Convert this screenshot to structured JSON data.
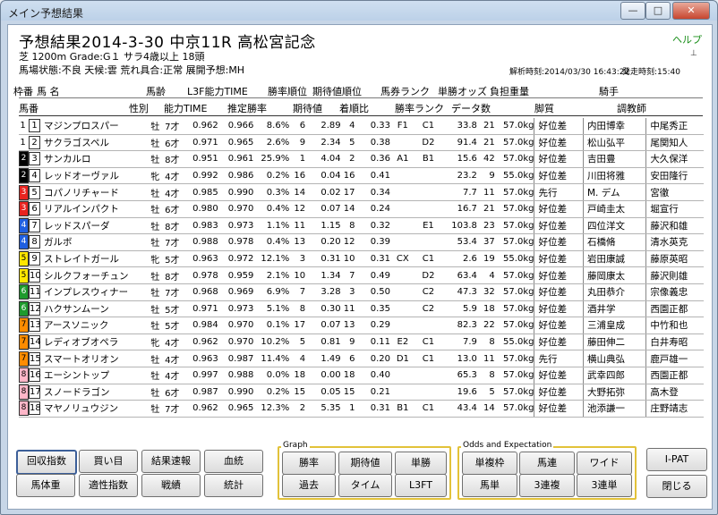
{
  "window": {
    "title": "メイン予想結果",
    "min": "—",
    "max": "□",
    "close": "✕"
  },
  "header": {
    "main": "予想結果2014-3-30 中京11R 高松宮記念",
    "help": "ヘルプ",
    "pin": "⊥",
    "line2": "芝 1200m  Grade:G１ サラ4歳以上 18頭",
    "line3": "馬場状態:不良  天候:雲  荒れ具合:正常  展開予想:MH",
    "analysis_time": "解析時刻:2014/03/30 16:43:22",
    "start_time": "発走時刻:15:40"
  },
  "columns_top": [
    "枠番",
    "馬 名",
    "馬齢",
    "L3F能力TIME",
    "勝率順位",
    "期待値順位",
    "馬券ランク",
    "単勝オッズ",
    "負担重量",
    "騎手"
  ],
  "columns_bottom": [
    "馬番",
    "性別",
    "能力TIME",
    "推定勝率",
    "期待値",
    "着順比",
    "勝率ランク",
    "データ数",
    "脚質",
    "調教師"
  ],
  "colors": {
    "frame1": "#ffffff",
    "frame2": "#000000",
    "frame3": "#e8231f",
    "frame4": "#1f5fe0",
    "frame5": "#ffe600",
    "frame6": "#1e9a2c",
    "frame7": "#ff8c00",
    "frame8": "#ffb6c8",
    "accent": "#e2c23a"
  },
  "rows": [
    {
      "w": "1",
      "n": "1",
      "name": "マジンプロスパー",
      "sex": "牡",
      "age": "7才",
      "t1": "0.962",
      "t2": "0.966",
      "rate": "8.6%",
      "rr": "6",
      "ev": "2.89",
      "er": "4",
      "cr": "0.33",
      "rk1": "F1",
      "rk2": "C1",
      "odds": "33.8",
      "dc": "21",
      "wt": "57.0kg",
      "style": "好位差",
      "jockey": "内田博幸",
      "trainer": "中尾秀正"
    },
    {
      "w": "1",
      "n": "2",
      "name": "サクラゴスペル",
      "sex": "牡",
      "age": "6才",
      "t1": "0.971",
      "t2": "0.965",
      "rate": "2.6%",
      "rr": "9",
      "ev": "2.34",
      "er": "5",
      "cr": "0.38",
      "rk1": "",
      "rk2": "D2",
      "odds": "91.4",
      "dc": "21",
      "wt": "57.0kg",
      "style": "好位差",
      "jockey": "松山弘平",
      "trainer": "尾関知人"
    },
    {
      "w": "2",
      "n": "3",
      "name": "サンカルロ",
      "sex": "牡",
      "age": "8才",
      "t1": "0.951",
      "t2": "0.961",
      "rate": "25.9%",
      "rr": "1",
      "ev": "4.04",
      "er": "2",
      "cr": "0.36",
      "rk1": "A1",
      "rk2": "B1",
      "odds": "15.6",
      "dc": "42",
      "wt": "57.0kg",
      "style": "好位差",
      "jockey": "吉田豊",
      "trainer": "大久保洋"
    },
    {
      "w": "2",
      "n": "4",
      "name": "レッドオーヴァル",
      "sex": "牝",
      "age": "4才",
      "t1": "0.992",
      "t2": "0.986",
      "rate": "0.2%",
      "rr": "16",
      "ev": "0.04",
      "er": "16",
      "cr": "0.41",
      "rk1": "",
      "rk2": "",
      "odds": "23.2",
      "dc": "9",
      "wt": "55.0kg",
      "style": "好位差",
      "jockey": "川田将雅",
      "trainer": "安田隆行"
    },
    {
      "w": "3",
      "n": "5",
      "name": "コパノリチャード",
      "sex": "牡",
      "age": "4才",
      "t1": "0.985",
      "t2": "0.990",
      "rate": "0.3%",
      "rr": "14",
      "ev": "0.02",
      "er": "17",
      "cr": "0.34",
      "rk1": "",
      "rk2": "",
      "odds": "7.7",
      "dc": "11",
      "wt": "57.0kg",
      "style": "先行",
      "jockey": "M. デム",
      "trainer": "宮徹"
    },
    {
      "w": "3",
      "n": "6",
      "name": "リアルインパクト",
      "sex": "牡",
      "age": "6才",
      "t1": "0.980",
      "t2": "0.970",
      "rate": "0.4%",
      "rr": "12",
      "ev": "0.07",
      "er": "14",
      "cr": "0.24",
      "rk1": "",
      "rk2": "",
      "odds": "16.7",
      "dc": "21",
      "wt": "57.0kg",
      "style": "好位差",
      "jockey": "戸崎圭太",
      "trainer": "堀宣行"
    },
    {
      "w": "4",
      "n": "7",
      "name": "レッドスパーダ",
      "sex": "牡",
      "age": "8才",
      "t1": "0.983",
      "t2": "0.973",
      "rate": "1.1%",
      "rr": "11",
      "ev": "1.15",
      "er": "8",
      "cr": "0.32",
      "rk1": "",
      "rk2": "E1",
      "odds": "103.8",
      "dc": "23",
      "wt": "57.0kg",
      "style": "好位差",
      "jockey": "四位洋文",
      "trainer": "藤沢和雄"
    },
    {
      "w": "4",
      "n": "8",
      "name": "ガルボ",
      "sex": "牡",
      "age": "7才",
      "t1": "0.988",
      "t2": "0.978",
      "rate": "0.4%",
      "rr": "13",
      "ev": "0.20",
      "er": "12",
      "cr": "0.39",
      "rk1": "",
      "rk2": "",
      "odds": "53.4",
      "dc": "37",
      "wt": "57.0kg",
      "style": "好位差",
      "jockey": "石橋脩",
      "trainer": "清水英克"
    },
    {
      "w": "5",
      "n": "9",
      "name": "ストレイトガール",
      "sex": "牝",
      "age": "5才",
      "t1": "0.963",
      "t2": "0.972",
      "rate": "12.1%",
      "rr": "3",
      "ev": "0.31",
      "er": "10",
      "cr": "0.31",
      "rk1": "CX",
      "rk2": "C1",
      "odds": "2.6",
      "dc": "19",
      "wt": "55.0kg",
      "style": "好位差",
      "jockey": "岩田康誠",
      "trainer": "藤原英昭"
    },
    {
      "w": "5",
      "n": "10",
      "name": "シルクフォーチュン",
      "sex": "牡",
      "age": "8才",
      "t1": "0.978",
      "t2": "0.959",
      "rate": "2.1%",
      "rr": "10",
      "ev": "1.34",
      "er": "7",
      "cr": "0.49",
      "rk1": "",
      "rk2": "D2",
      "odds": "63.4",
      "dc": "4",
      "wt": "57.0kg",
      "style": "好位差",
      "jockey": "藤岡康太",
      "trainer": "藤沢則雄"
    },
    {
      "w": "6",
      "n": "11",
      "name": "インプレスウィナー",
      "sex": "牡",
      "age": "7才",
      "t1": "0.968",
      "t2": "0.969",
      "rate": "6.9%",
      "rr": "7",
      "ev": "3.28",
      "er": "3",
      "cr": "0.50",
      "rk1": "",
      "rk2": "C2",
      "odds": "47.3",
      "dc": "32",
      "wt": "57.0kg",
      "style": "好位差",
      "jockey": "丸田恭介",
      "trainer": "宗像義忠"
    },
    {
      "w": "6",
      "n": "12",
      "name": "ハクサンムーン",
      "sex": "牡",
      "age": "5才",
      "t1": "0.971",
      "t2": "0.973",
      "rate": "5.1%",
      "rr": "8",
      "ev": "0.30",
      "er": "11",
      "cr": "0.35",
      "rk1": "",
      "rk2": "C2",
      "odds": "5.9",
      "dc": "18",
      "wt": "57.0kg",
      "style": "好位差",
      "jockey": "酒井学",
      "trainer": "西園正都"
    },
    {
      "w": "7",
      "n": "13",
      "name": "アースソニック",
      "sex": "牡",
      "age": "5才",
      "t1": "0.984",
      "t2": "0.970",
      "rate": "0.1%",
      "rr": "17",
      "ev": "0.07",
      "er": "13",
      "cr": "0.29",
      "rk1": "",
      "rk2": "",
      "odds": "82.3",
      "dc": "22",
      "wt": "57.0kg",
      "style": "好位差",
      "jockey": "三浦皇成",
      "trainer": "中竹和也"
    },
    {
      "w": "7",
      "n": "14",
      "name": "レディオブオペラ",
      "sex": "牝",
      "age": "4才",
      "t1": "0.962",
      "t2": "0.970",
      "rate": "10.2%",
      "rr": "5",
      "ev": "0.81",
      "er": "9",
      "cr": "0.11",
      "rk1": "E2",
      "rk2": "C1",
      "odds": "7.9",
      "dc": "8",
      "wt": "55.0kg",
      "style": "好位差",
      "jockey": "藤田伸二",
      "trainer": "白井寿昭"
    },
    {
      "w": "7",
      "n": "15",
      "name": "スマートオリオン",
      "sex": "牡",
      "age": "4才",
      "t1": "0.963",
      "t2": "0.987",
      "rate": "11.4%",
      "rr": "4",
      "ev": "1.49",
      "er": "6",
      "cr": "0.20",
      "rk1": "D1",
      "rk2": "C1",
      "odds": "13.0",
      "dc": "11",
      "wt": "57.0kg",
      "style": "先行",
      "jockey": "横山典弘",
      "trainer": "鹿戸雄一"
    },
    {
      "w": "8",
      "n": "16",
      "name": "エーシントップ",
      "sex": "牡",
      "age": "4才",
      "t1": "0.997",
      "t2": "0.988",
      "rate": "0.0%",
      "rr": "18",
      "ev": "0.00",
      "er": "18",
      "cr": "0.40",
      "rk1": "",
      "rk2": "",
      "odds": "65.3",
      "dc": "8",
      "wt": "57.0kg",
      "style": "好位差",
      "jockey": "武幸四郎",
      "trainer": "西園正都"
    },
    {
      "w": "8",
      "n": "17",
      "name": "スノードラゴン",
      "sex": "牡",
      "age": "6才",
      "t1": "0.987",
      "t2": "0.990",
      "rate": "0.2%",
      "rr": "15",
      "ev": "0.05",
      "er": "15",
      "cr": "0.21",
      "rk1": "",
      "rk2": "",
      "odds": "19.6",
      "dc": "5",
      "wt": "57.0kg",
      "style": "好位差",
      "jockey": "大野拓弥",
      "trainer": "高木登"
    },
    {
      "w": "8",
      "n": "18",
      "name": "マヤノリュウジン",
      "sex": "牡",
      "age": "7才",
      "t1": "0.962",
      "t2": "0.965",
      "rate": "12.3%",
      "rr": "2",
      "ev": "5.35",
      "er": "1",
      "cr": "0.31",
      "rk1": "B1",
      "rk2": "C1",
      "odds": "43.4",
      "dc": "14",
      "wt": "57.0kg",
      "style": "好位差",
      "jockey": "池添謙一",
      "trainer": "庄野靖志"
    }
  ],
  "buttons_left": [
    "回収指数",
    "買い目",
    "結果速報",
    "血統",
    "馬体重",
    "適性指数",
    "戦績",
    "統計"
  ],
  "graph_group": {
    "label": "Graph",
    "buttons": [
      "勝率",
      "期待値",
      "単勝",
      "過去",
      "タイム",
      "L3FT"
    ]
  },
  "odds_group": {
    "label": "Odds and Expectation",
    "buttons": [
      "単複枠",
      "馬連",
      "ワイド",
      "馬単",
      "3連複",
      "3連単"
    ]
  },
  "buttons_right": [
    "I-PAT",
    "閉じる"
  ]
}
